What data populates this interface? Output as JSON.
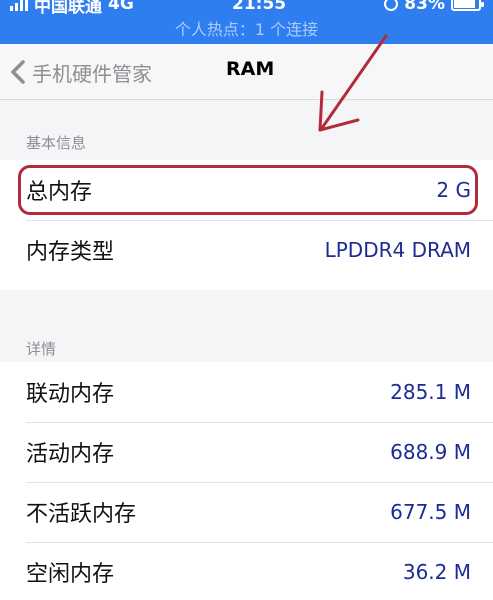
{
  "status_bar": {
    "carrier": "中国联通",
    "network": "4G",
    "time": "21:55",
    "battery": "83%",
    "hotspot": "个人热点：1 个连接"
  },
  "nav": {
    "back_label": "手机硬件管家",
    "title": "RAM"
  },
  "sections": [
    {
      "header": "基本信息",
      "rows": [
        {
          "label": "总内存",
          "value": "2 G"
        },
        {
          "label": "内存类型",
          "value": "LPDDR4 DRAM"
        }
      ]
    },
    {
      "header": "详情",
      "rows": [
        {
          "label": "联动内存",
          "value": "285.1 M"
        },
        {
          "label": "活动内存",
          "value": "688.9 M"
        },
        {
          "label": "不活跃内存",
          "value": "677.5 M"
        },
        {
          "label": "空闲内存",
          "value": "36.2 M"
        }
      ]
    }
  ],
  "colors": {
    "status_bar": "#2f7ef0",
    "value_text": "#1d2c95",
    "annotation": "#b32a3a"
  }
}
